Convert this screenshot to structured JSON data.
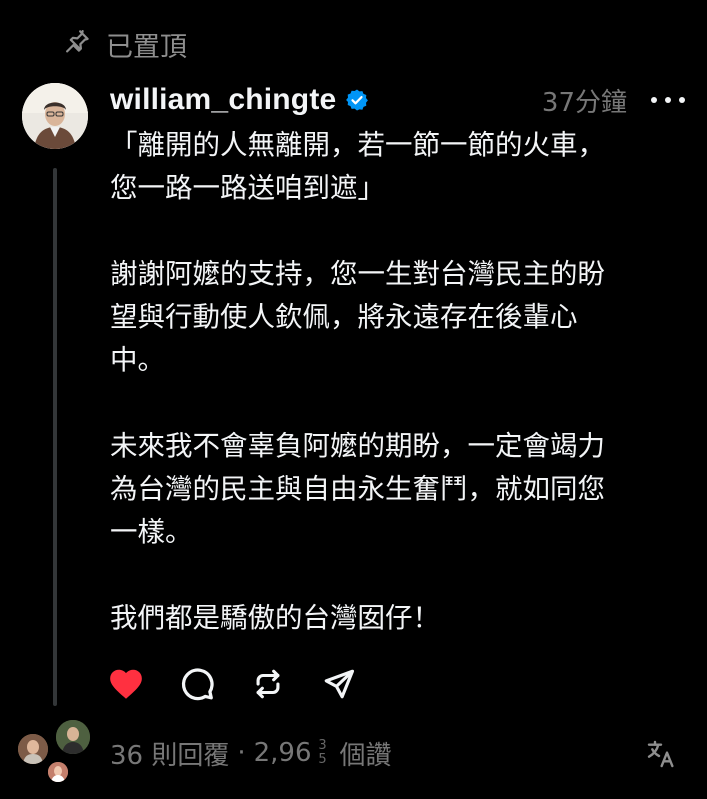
{
  "pinned": {
    "label": "已置頂"
  },
  "post": {
    "username": "william_chingte",
    "timestamp": "37分鐘",
    "paragraphs": [
      [
        "「離開的人無離開，若一節一節的火車，",
        "您一路一路送咱到遮」"
      ],
      [
        "謝謝阿嬤的支持，您一生對台灣民主的盼",
        "望與行動使人欽佩，將永遠存在後輩心",
        "中。"
      ],
      [
        "未來我不會辜負阿嬤的期盼，一定會竭力",
        "為台灣的民主與自由永生奮鬥，就如同您",
        "一樣。"
      ],
      [
        "我們都是驕傲的台灣囡仔！"
      ]
    ],
    "liked": true
  },
  "stats": {
    "replies": "36 則回覆",
    "separator": "·",
    "likes_prefix": "2,96",
    "likes_rolling_top": "3",
    "likes_rolling_bottom": "5",
    "likes_suffix": "個讚"
  },
  "colors": {
    "background": "#000000",
    "text_primary": "#f3f5f7",
    "text_secondary": "#777777",
    "like_red": "#ff3040",
    "verified_blue": "#0095f6"
  },
  "icons": [
    "pin-icon",
    "verified-badge-icon",
    "more-icon",
    "heart-icon",
    "comment-icon",
    "repost-icon",
    "share-icon",
    "translate-icon"
  ]
}
